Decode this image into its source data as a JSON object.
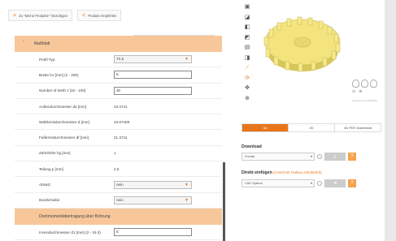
{
  "toolbar": {
    "add_label": "Zu \"Meine Produkte\" hinzufügen",
    "recommend_label": "Produkt empfehlen"
  },
  "sections": {
    "dimensions": "Maßblatt",
    "torque": "Drehmomentübertragung über Bohrung"
  },
  "rows": [
    {
      "label": "Profil-Typ",
      "value": "T2,5",
      "type": "select"
    },
    {
      "label": "Breite b1 [mm] (2 - 200)",
      "value": "6",
      "type": "input"
    },
    {
      "label": "Number of teeth z [10 - 100]",
      "value": "30",
      "type": "input"
    },
    {
      "label": "Außendurchmesser da [mm]",
      "value": "23.3741",
      "type": "text"
    },
    {
      "label": "Wälzkreisdurchmesser d [mm]",
      "value": "23.87409",
      "type": "text"
    },
    {
      "label": "Fußkreisdurchmesser df [mm]",
      "value": "21.3741",
      "type": "text"
    },
    {
      "label": "Zahnhöhe hg [mm]",
      "value": "1",
      "type": "text"
    },
    {
      "label": "Teilung p [mm]",
      "value": "2.5",
      "type": "text"
    },
    {
      "label": "Absatz",
      "value": "nein",
      "type": "select"
    },
    {
      "label": "Bordscheibe",
      "value": "nein",
      "type": "select"
    }
  ],
  "bore_row": {
    "label": "Innendurchmesser d1 [mm] (2 - 19.3)",
    "value": "6"
  },
  "view_tabs": [
    "3D",
    "2D",
    "3D PDF-Datenblatt"
  ],
  "download": {
    "heading": "Download",
    "format_placeholder": "Format",
    "download_icon": "download-icon"
  },
  "cad": {
    "heading": "Direkt einfügen",
    "note": "(CAD/CAD Toolbox erforderlich)",
    "system_placeholder": "CAD System"
  },
  "help_symbol": "?",
  "accent": "#e8751a",
  "section_bg": "#f7c79a"
}
